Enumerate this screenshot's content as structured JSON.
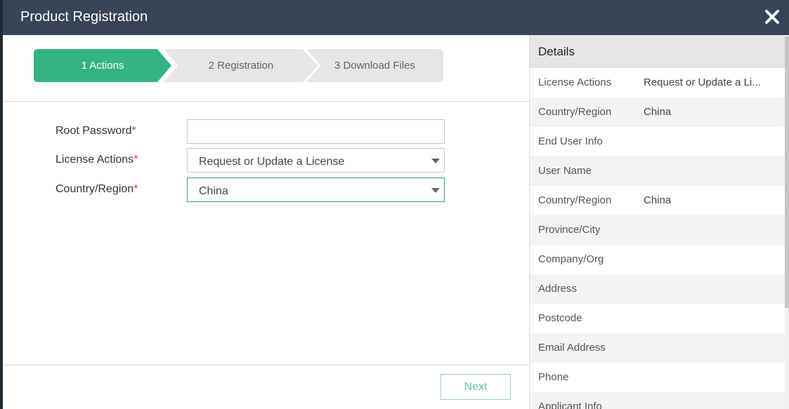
{
  "dialog": {
    "title": "Product Registration"
  },
  "steps": [
    {
      "label": "1 Actions",
      "active": true
    },
    {
      "label": "2 Registration",
      "active": false
    },
    {
      "label": "3 Download Files",
      "active": false
    }
  ],
  "form": {
    "root_password": {
      "label": "Root Password",
      "required_mark": "*",
      "value": ""
    },
    "license_actions": {
      "label": "License Actions",
      "required_mark": "*",
      "value": "Request or Update a License"
    },
    "country_region": {
      "label": "Country/Region",
      "required_mark": "*",
      "value": "China"
    }
  },
  "footer": {
    "next_label": "Next"
  },
  "details": {
    "title": "Details",
    "rows": [
      {
        "label": "License Actions",
        "value": "Request or Update a Li..."
      },
      {
        "label": "Country/Region",
        "value": "China"
      },
      {
        "label": "End User Info",
        "value": ""
      },
      {
        "label": "User Name",
        "value": ""
      },
      {
        "label": "Country/Region",
        "value": "China"
      },
      {
        "label": "Province/City",
        "value": ""
      },
      {
        "label": "Company/Org",
        "value": ""
      },
      {
        "label": "Address",
        "value": ""
      },
      {
        "label": "Postcode",
        "value": ""
      },
      {
        "label": "Email Address",
        "value": ""
      },
      {
        "label": "Phone",
        "value": ""
      },
      {
        "label": "Applicant Info",
        "value": ""
      }
    ]
  },
  "colors": {
    "titlebar": "#384556",
    "accent": "#33b485",
    "step_inactive": "#e6e6e6",
    "required": "#e5322d"
  }
}
